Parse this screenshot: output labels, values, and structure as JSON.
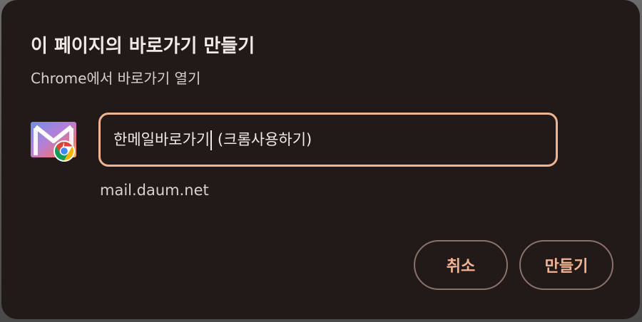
{
  "dialog": {
    "title": "이 페이지의 바로가기 만들기",
    "subtitle": "Chrome에서 바로가기 열기"
  },
  "shortcut": {
    "name_before_caret": "한메일바로가기",
    "name_after_caret": " (크롬사용하기)",
    "url": "mail.daum.net",
    "icon": "gmail-chrome-shortcut-icon"
  },
  "buttons": {
    "cancel_label": "취소",
    "create_label": "만들기"
  },
  "colors": {
    "dialog_bg": "#221a19",
    "accent": "#f0b493",
    "text_primary": "#f1e9e7",
    "text_secondary": "#d9cfcc",
    "button_border": "#8a726b"
  }
}
